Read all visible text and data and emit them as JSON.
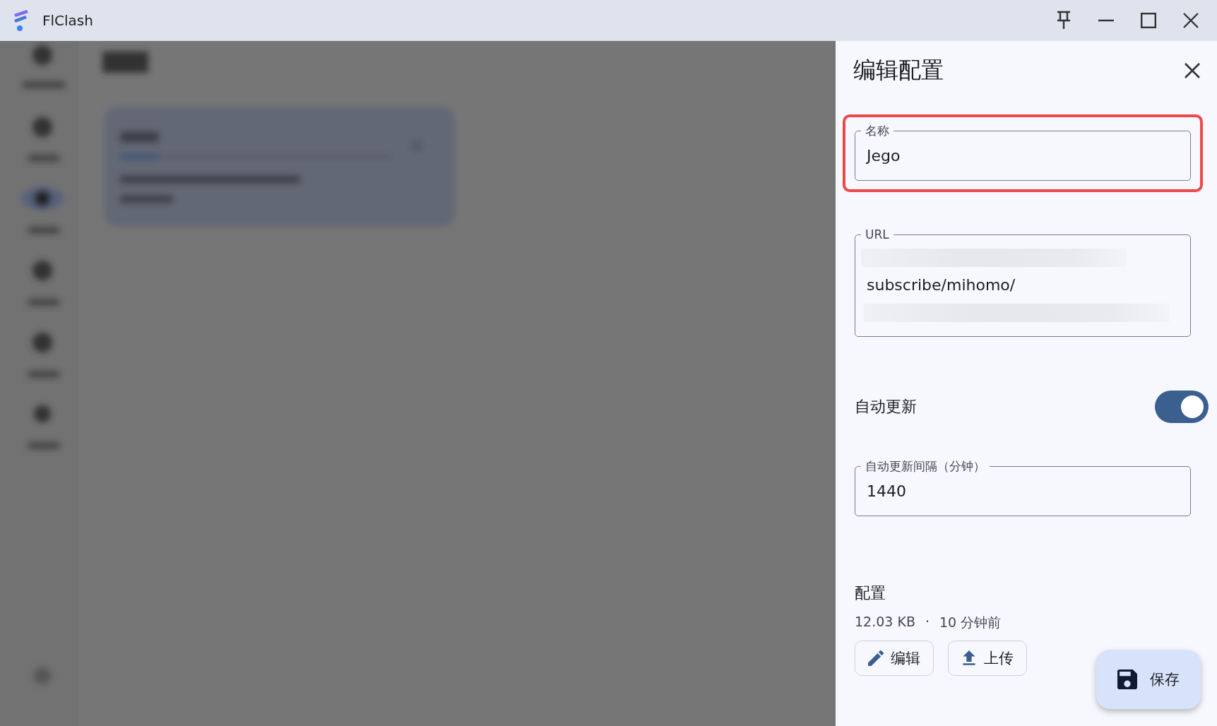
{
  "window": {
    "title": "FlClash"
  },
  "panel": {
    "title": "编辑配置",
    "fields": [
      {
        "kind": "text",
        "label": "名称",
        "value": "Jego",
        "highlighted": true
      },
      {
        "kind": "url",
        "label": "URL",
        "value": "subscribe/mihomo/",
        "highlighted": false
      },
      {
        "kind": "text",
        "label": "自动更新间隔（分钟）",
        "value": "1440",
        "highlighted": false
      }
    ],
    "toggle": {
      "label": "自动更新",
      "on": true
    },
    "config": {
      "heading": "配置",
      "size": "12.03 KB",
      "separator": "·",
      "updated": "10 分钟前",
      "buttons": [
        {
          "kind": "edit",
          "label": "编辑"
        },
        {
          "kind": "upload",
          "label": "上传"
        }
      ]
    },
    "save_button": {
      "label": "保存"
    }
  }
}
